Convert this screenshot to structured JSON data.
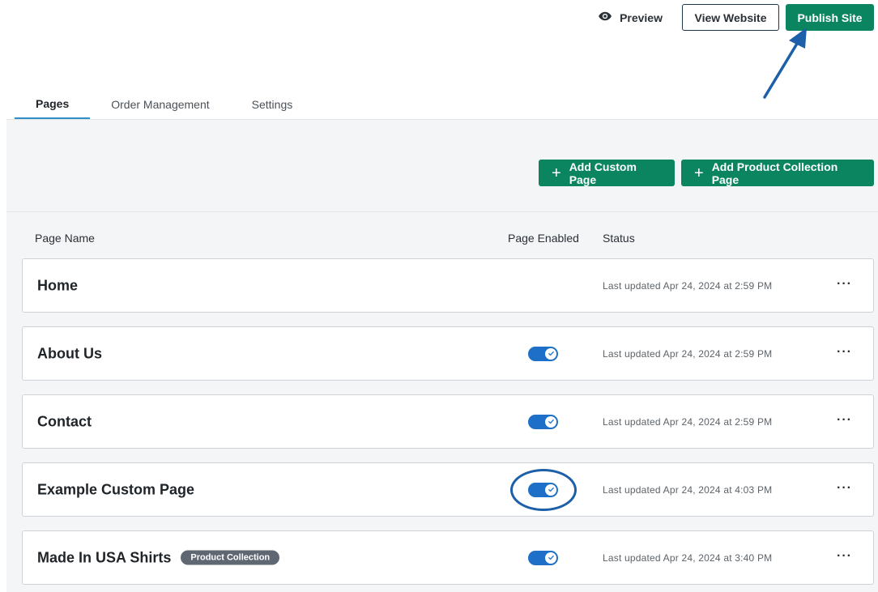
{
  "header": {
    "preview_label": "Preview",
    "view_website_label": "View Website",
    "publish_label": "Publish Site"
  },
  "tabs": [
    {
      "label": "Pages",
      "active": true
    },
    {
      "label": "Order Management",
      "active": false
    },
    {
      "label": "Settings",
      "active": false
    }
  ],
  "actions": {
    "add_custom_label": "Add Custom Page",
    "add_collection_label": "Add Product Collection Page"
  },
  "table": {
    "headers": {
      "name": "Page Name",
      "enabled": "Page Enabled",
      "status": "Status"
    },
    "rows": [
      {
        "name": "Home",
        "enabled": null,
        "status": "Last updated Apr 24, 2024 at 2:59 PM",
        "badge": null
      },
      {
        "name": "About Us",
        "enabled": true,
        "status": "Last updated Apr 24, 2024 at 2:59 PM",
        "badge": null
      },
      {
        "name": "Contact",
        "enabled": true,
        "status": "Last updated Apr 24, 2024 at 2:59 PM",
        "badge": null
      },
      {
        "name": "Example Custom Page",
        "enabled": true,
        "status": "Last updated Apr 24, 2024 at 4:03 PM",
        "badge": null
      },
      {
        "name": "Made In USA Shirts",
        "enabled": true,
        "status": "Last updated Apr 24, 2024 at 3:40 PM",
        "badge": "Product Collection"
      }
    ],
    "menu_glyph": "···"
  },
  "colors": {
    "primary_green": "#0a8560",
    "toggle_blue": "#1d6fc7",
    "annotation_blue": "#1d5fa8"
  },
  "icons": {
    "preview": "eye-icon",
    "add": "plus-icon",
    "toggle_check": "check-icon",
    "row_menu": "more-horizontal-icon"
  }
}
